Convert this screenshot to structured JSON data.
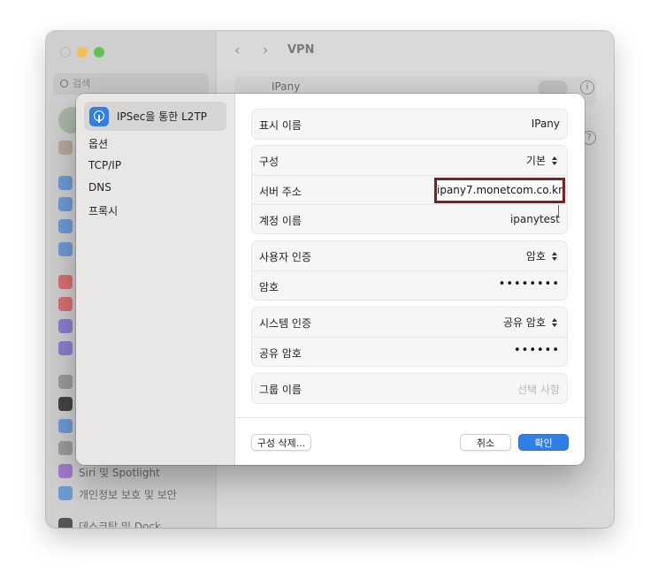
{
  "background_window": {
    "title": "VPN",
    "search_placeholder": "검색",
    "vpn_row_label": "IPany",
    "info_glyph": "i",
    "help_glyph": "?",
    "sidebar_items": [
      "Siri 및 Spotlight",
      "개인정보 보호 및 보안",
      "데스크탑 및 Dock"
    ]
  },
  "sheet": {
    "sidebar": {
      "selected": "IPSec을 통한 L2TP",
      "items": [
        "옵션",
        "TCP/IP",
        "DNS",
        "프록시"
      ]
    },
    "display_name": {
      "label": "표시 이름",
      "value": "IPany"
    },
    "config": {
      "label": "구성",
      "value": "기본"
    },
    "server": {
      "label": "서버 주소",
      "value": "ipany7.monetcom.co.kr"
    },
    "account": {
      "label": "계정 이름",
      "value": "ipanytest"
    },
    "user_auth": {
      "label": "사용자 인증",
      "value": "암호"
    },
    "password": {
      "label": "암호",
      "value": "••••••••"
    },
    "system_auth": {
      "label": "시스템 인증",
      "value": "공유 암호"
    },
    "shared_secret": {
      "label": "공유 암호",
      "value": "••••••"
    },
    "group_name": {
      "label": "그룹 이름",
      "placeholder": "선택 사항"
    },
    "buttons": {
      "delete_config": "구성 삭제...",
      "cancel": "취소",
      "ok": "확인"
    }
  },
  "colors": {
    "accent": "#2f7fe6",
    "highlight_border": "#7f1f1f"
  }
}
